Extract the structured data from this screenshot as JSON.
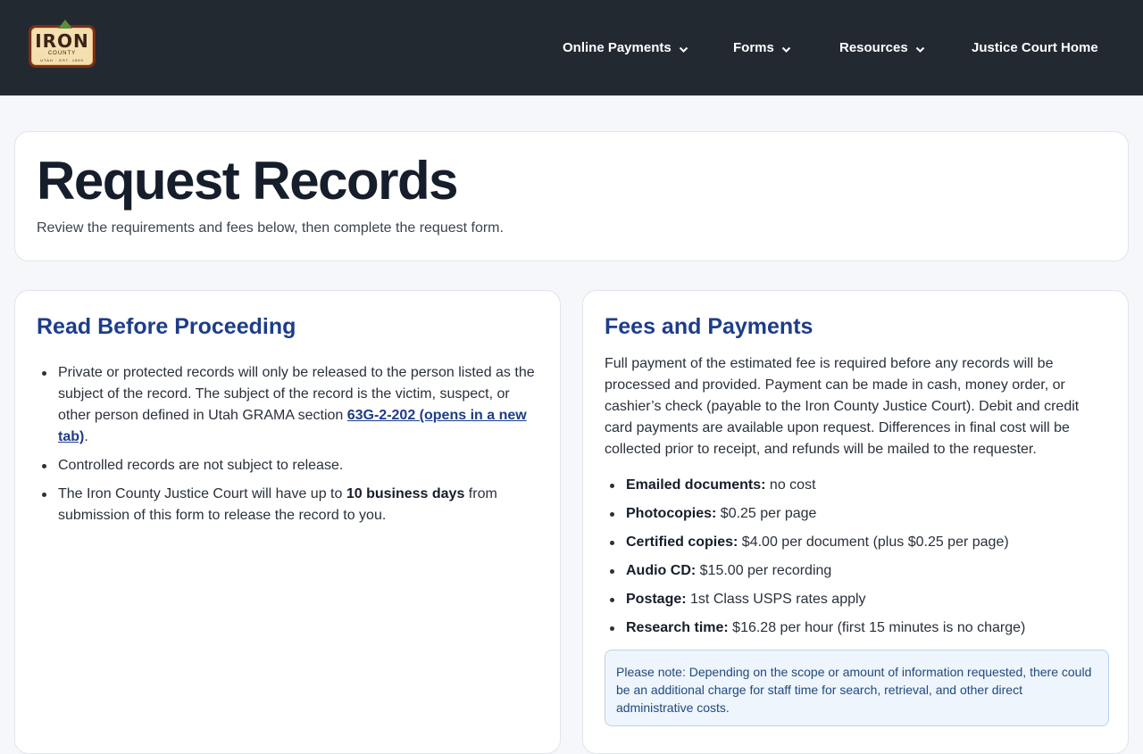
{
  "logo": {
    "word": "IRON",
    "sub": "COUNTY",
    "tiny": "UTAH · EST. 1850"
  },
  "nav": {
    "items": [
      {
        "label": "Online Payments",
        "has_dropdown": true
      },
      {
        "label": "Forms",
        "has_dropdown": true
      },
      {
        "label": "Resources",
        "has_dropdown": true
      },
      {
        "label": "Justice Court Home",
        "has_dropdown": false
      }
    ]
  },
  "page": {
    "title": "Request Records",
    "subtitle": "Review the requirements and fees below, then complete the request form."
  },
  "read_before": {
    "heading": "Read Before Proceeding",
    "bullet1_text": "Private or protected records will only be released to the person listed as the subject of the record. The subject of the record is the victim, suspect, or other person defined in Utah GRAMA section ",
    "bullet1_link": "63G-2-202 (opens in a new tab)",
    "bullet1_end": ".",
    "bullet2": "Controlled records are not subject to release.",
    "bullet3_pre": "The Iron County Justice Court will have up to ",
    "bullet3_bold": "10 business days",
    "bullet3_post": " from submission of this form to release the record to you."
  },
  "fees": {
    "heading": "Fees and Payments",
    "intro": "Full payment of the estimated fee is required before any records will be processed and provided. Payment can be made in cash, money order, or cashier’s check (payable to the Iron County Justice Court). Debit and credit card payments are available upon request. Differences in final cost will be collected prior to receipt, and refunds will be mailed to the requester.",
    "items": [
      {
        "label": "Emailed documents:",
        "value": " no cost"
      },
      {
        "label": "Photocopies:",
        "value": " $0.25 per page"
      },
      {
        "label": "Certified copies:",
        "value": " $4.00 per document (plus $0.25 per page)"
      },
      {
        "label": "Audio CD:",
        "value": " $15.00 per recording"
      },
      {
        "label": "Postage:",
        "value": " 1st Class USPS rates apply"
      },
      {
        "label": "Research time:",
        "value": " $16.28 per hour (first 15 minutes is no charge)"
      }
    ],
    "note": "Please note: Depending on the scope or amount of information requested, there could be an additional charge for staff time for search, retrieval, and other direct administrative costs."
  },
  "colors": {
    "header_bg": "#232931",
    "heading_blue": "#1d3d8a",
    "page_bg": "#f5f7fa",
    "note_bg": "#eef5fc"
  }
}
